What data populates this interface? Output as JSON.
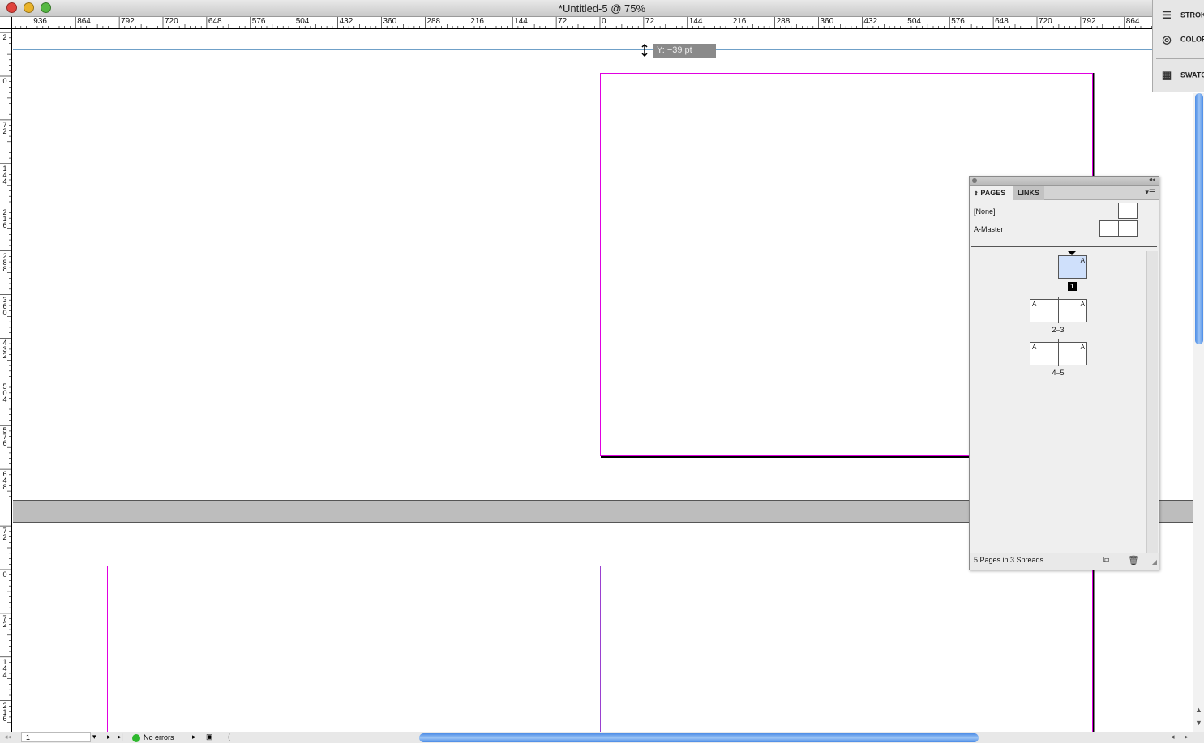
{
  "window": {
    "title": "*Untitled-5 @ 75%"
  },
  "rulers": {
    "horizontal_labels": [
      "936",
      "864",
      "792",
      "720",
      "648",
      "576",
      "504",
      "432",
      "360",
      "288",
      "216",
      "144",
      "72",
      "0",
      "72",
      "144",
      "216",
      "288",
      "360",
      "432",
      "504",
      "576",
      "648",
      "720",
      "792",
      "864"
    ],
    "vertical_top_labels": [
      "2",
      "0",
      "7\n2",
      "1\n4\n4",
      "2\n1\n6",
      "2\n8\n8",
      "3\n6\n0",
      "4\n3\n2",
      "5\n0\n4",
      "5\n7\n6",
      "6\n4\n8"
    ],
    "vertical_bottom_labels": [
      "7\n2",
      "0",
      "7\n2",
      "1\n4\n4",
      "2\n1\n6"
    ]
  },
  "tooltip": {
    "text": "Y: −39 pt"
  },
  "dock": {
    "items": [
      {
        "label": "STROKE",
        "icon": "stroke-icon"
      },
      {
        "label": "COLOR",
        "icon": "color-icon"
      },
      {
        "label": "SWATCHES",
        "icon": "swatches-icon"
      }
    ]
  },
  "pages_panel": {
    "tabs": [
      "PAGES",
      "LINKS"
    ],
    "masters": [
      "[None]",
      "A-Master"
    ],
    "page_labels": [
      "1",
      "2–3",
      "4–5"
    ],
    "master_prefix": "A",
    "footer": "5 Pages in 3 Spreads"
  },
  "statusbar": {
    "page_number": "1",
    "preflight": "No errors"
  },
  "colors": {
    "margin": "#e000e0",
    "guide": "#6fa0c8",
    "scroll_accent": "#4c8ce6",
    "preflight_ok": "#2eb82e"
  }
}
